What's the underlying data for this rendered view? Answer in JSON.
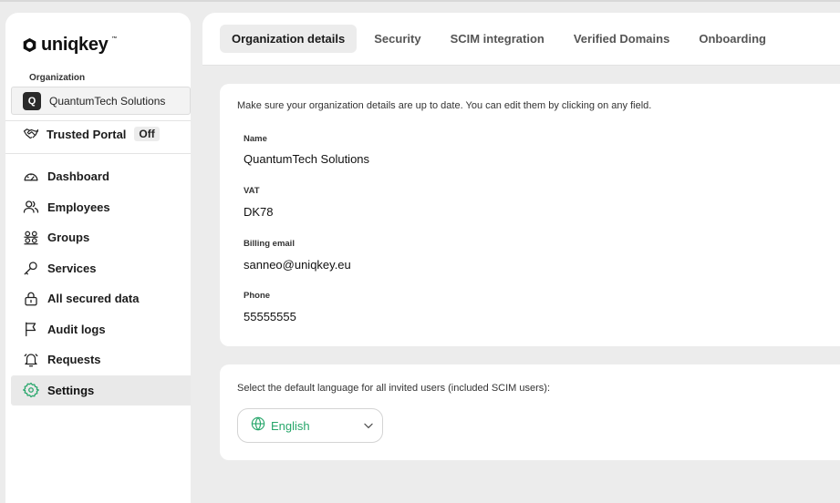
{
  "brand": {
    "logo_text": "uniqkey",
    "logo_tm": "™"
  },
  "sidebar": {
    "org_label": "Organization",
    "org_initial": "Q",
    "org_name": "QuantumTech Solutions",
    "trusted_portal": {
      "label": "Trusted Portal",
      "status": "Off"
    },
    "items": [
      {
        "label": "Dashboard",
        "icon": "gauge-icon"
      },
      {
        "label": "Employees",
        "icon": "users-icon"
      },
      {
        "label": "Groups",
        "icon": "groups-icon"
      },
      {
        "label": "Services",
        "icon": "key-icon"
      },
      {
        "label": "All secured data",
        "icon": "lock-icon"
      },
      {
        "label": "Audit logs",
        "icon": "flag-icon"
      },
      {
        "label": "Requests",
        "icon": "bell-icon"
      },
      {
        "label": "Settings",
        "icon": "gear-icon",
        "active": true
      }
    ]
  },
  "tabs": [
    {
      "label": "Organization details",
      "active": true
    },
    {
      "label": "Security"
    },
    {
      "label": "SCIM integration"
    },
    {
      "label": "Verified Domains"
    },
    {
      "label": "Onboarding"
    }
  ],
  "details": {
    "intro": "Make sure your organization details are up to date. You can edit them by clicking on any field.",
    "fields": [
      {
        "label": "Name",
        "value": "QuantumTech Solutions"
      },
      {
        "label": "VAT",
        "value": "DK78"
      },
      {
        "label": "Billing email",
        "value": "sanneo@uniqkey.eu"
      },
      {
        "label": "Phone",
        "value": "55555555"
      }
    ]
  },
  "language": {
    "intro": "Select the default language for all invited users (included SCIM users):",
    "selected": "English"
  },
  "colors": {
    "accent": "#26a66a",
    "text": "#1c1c1c",
    "background": "#ececec"
  }
}
